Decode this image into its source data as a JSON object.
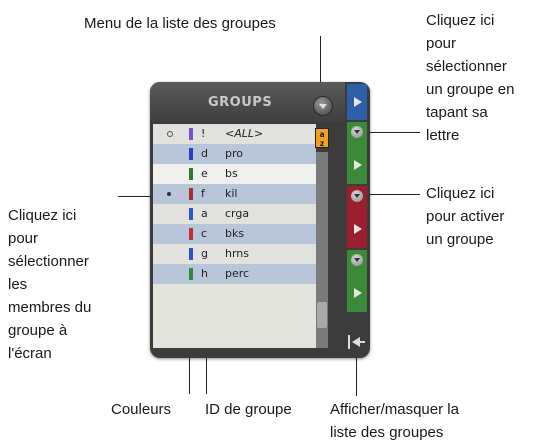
{
  "callouts": {
    "menu": "Menu de la liste des groupes",
    "select_by_letter": "Cliquez ici\npour\nsélectionner\nun groupe en\ntapant sa\nlettre",
    "activate": "Cliquez ici\npour activer\nun groupe",
    "select_members": "Cliquez ici\npour\nsélectionner\nles\nmembres du\ngroupe à\nl'écran",
    "colors": "Couleurs",
    "group_id": "ID de groupe",
    "show_hide": "Afficher/masquer la\nliste des groupes"
  },
  "panel": {
    "title": "GROUPS",
    "az_label_top": "a",
    "az_label_bottom": "z"
  },
  "groups": [
    {
      "id": "!",
      "name": "<ALL>",
      "color": "#7a4fd0",
      "selected": "hollow"
    },
    {
      "id": "d",
      "name": "pro",
      "color": "#2a3fb8",
      "selected": ""
    },
    {
      "id": "e",
      "name": "bs",
      "color": "#2f7a2f",
      "selected": ""
    },
    {
      "id": "f",
      "name": "kil",
      "color": "#b02a2a",
      "selected": "filled"
    },
    {
      "id": "a",
      "name": "crga",
      "color": "#2d55d0",
      "selected": ""
    },
    {
      "id": "c",
      "name": "bks",
      "color": "#c8283c",
      "selected": ""
    },
    {
      "id": "g",
      "name": "hrns",
      "color": "#2f4fd0",
      "selected": ""
    },
    {
      "id": "h",
      "name": "perc",
      "color": "#2d8a3a",
      "selected": ""
    }
  ],
  "side_strip": {
    "blue": "#2d5ea8",
    "green": "#3a8a3a",
    "red": "#9a1e2e"
  }
}
